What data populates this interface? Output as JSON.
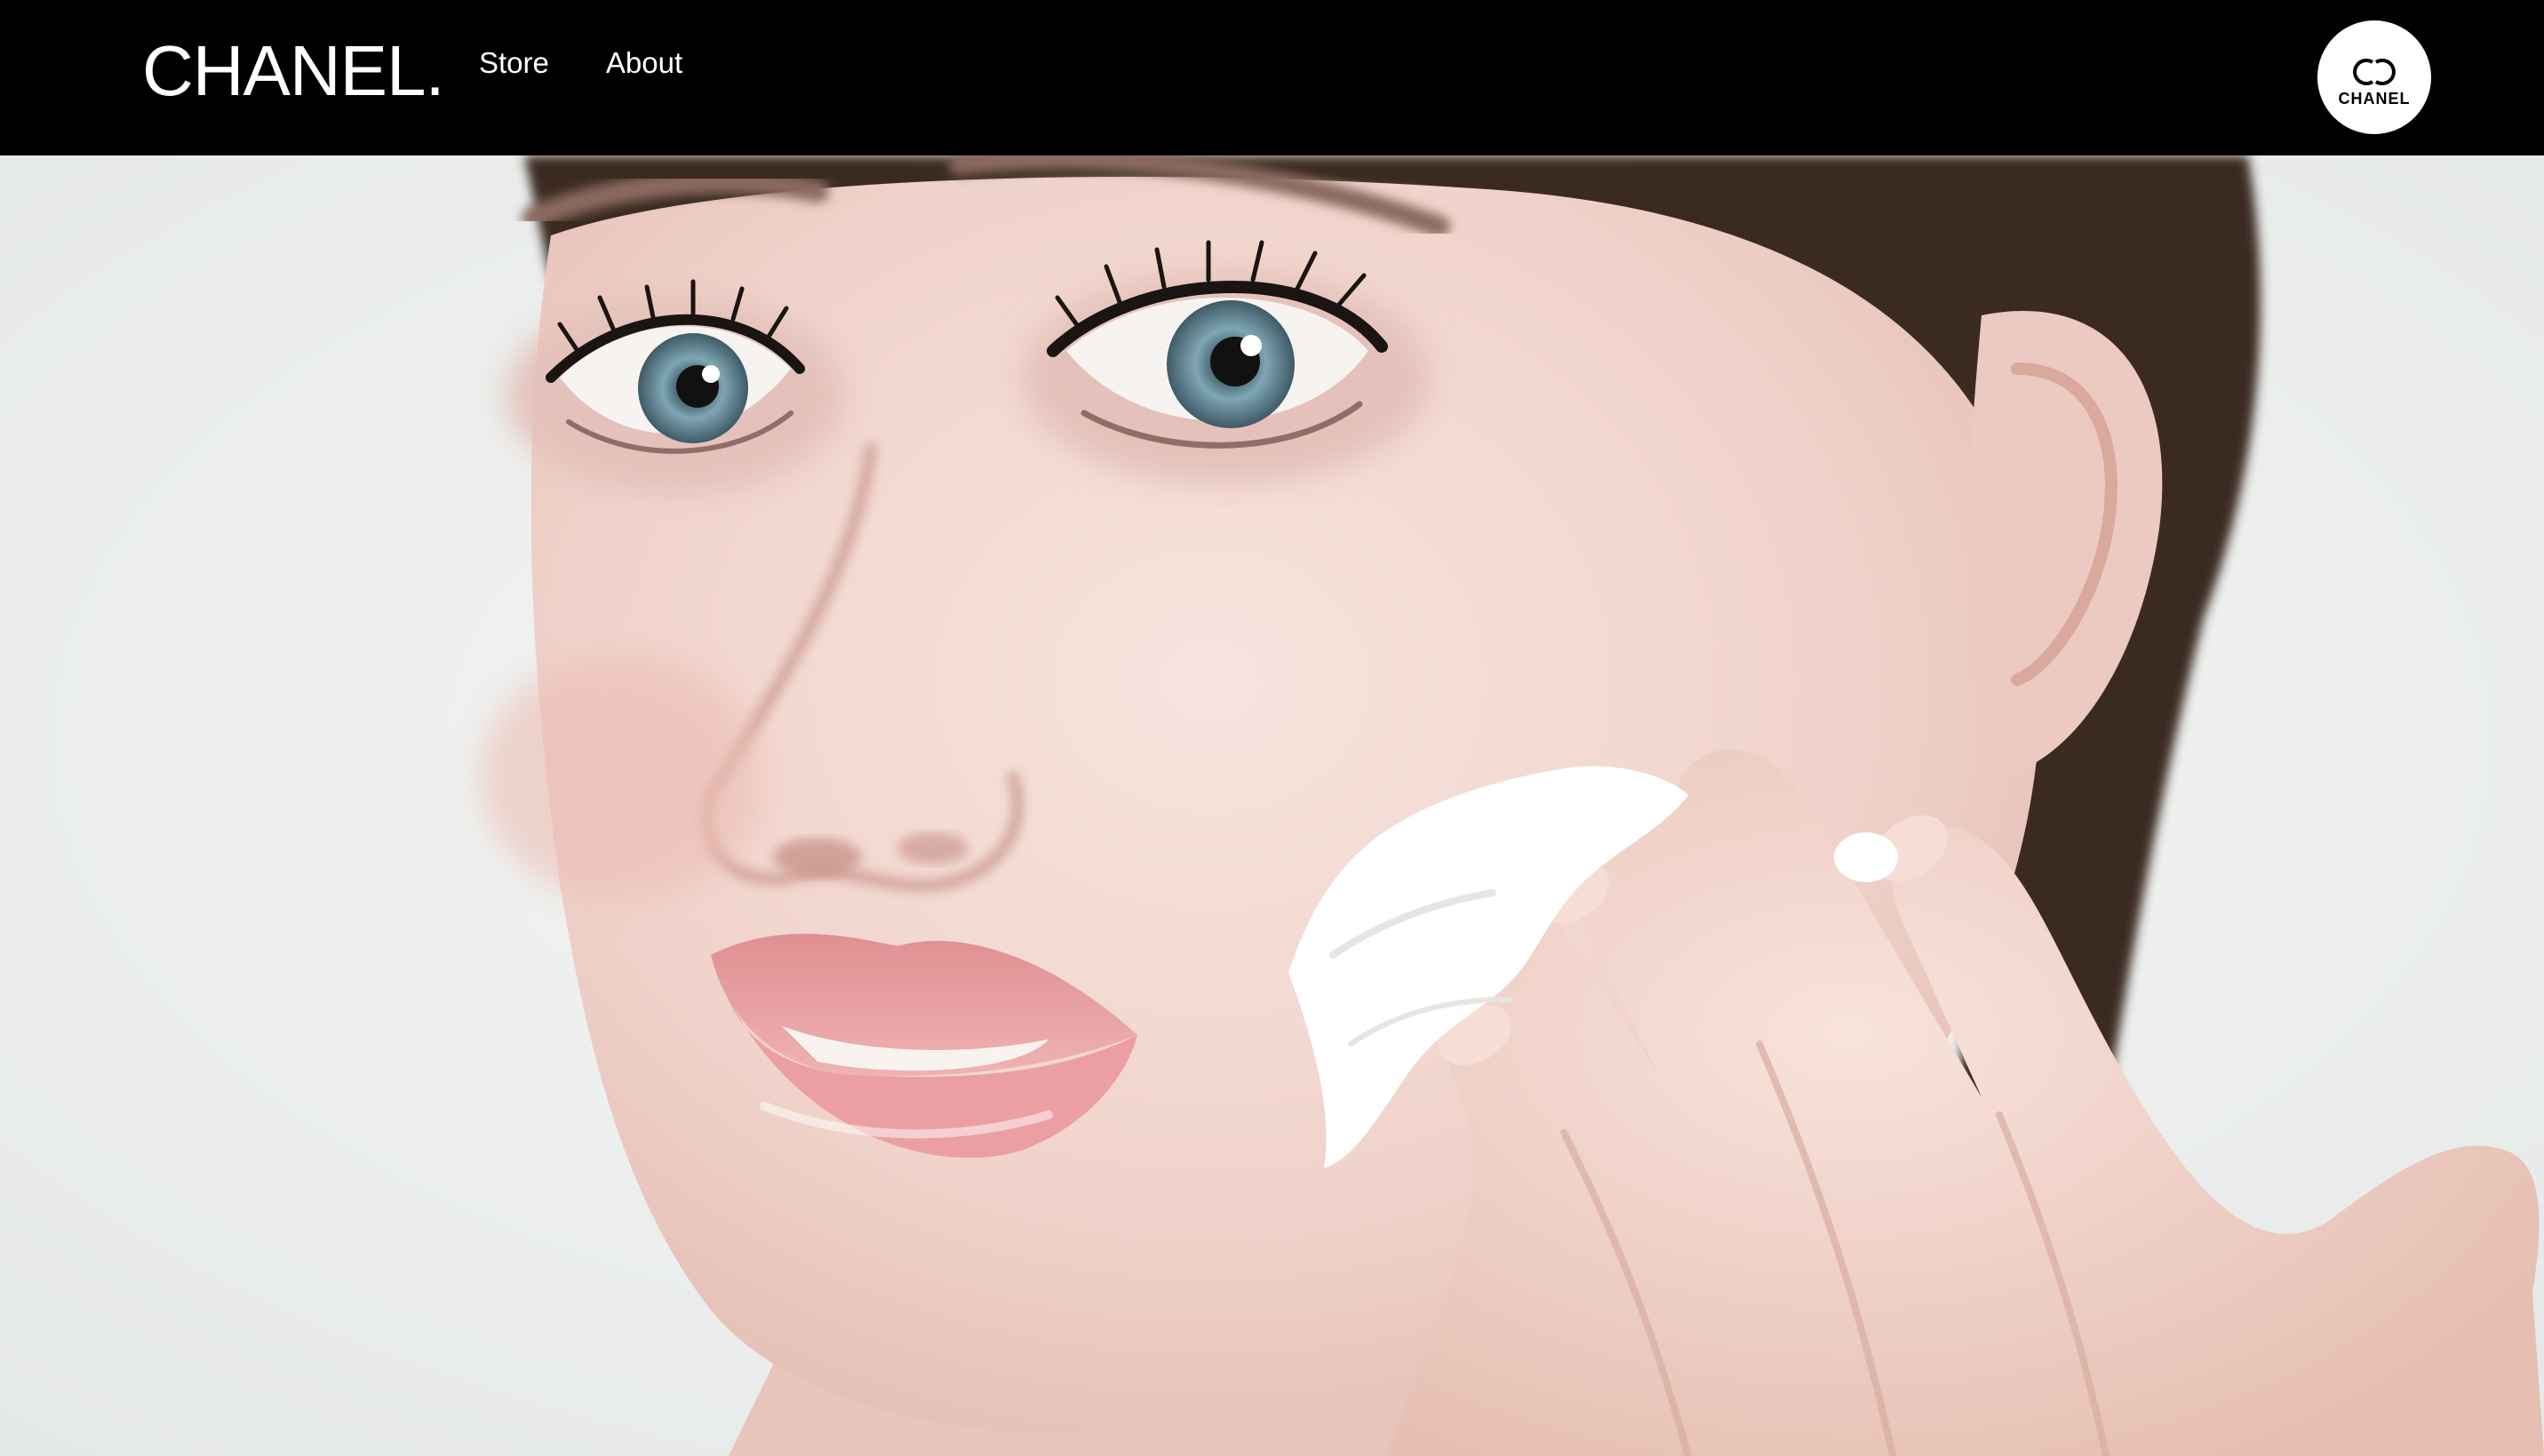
{
  "header": {
    "brand": "CHANEL.",
    "nav": [
      {
        "label": "Store"
      },
      {
        "label": "About"
      }
    ],
    "badge": {
      "text": "CHANEL",
      "icon": "chanel-cc-logo-icon"
    }
  },
  "hero": {
    "image": "beauty-portrait-applying-cream",
    "colors": {
      "background": "#eef0ee",
      "skin": "#f2d8d2",
      "hair": "#3a2a24",
      "iris": "#7fa6b4",
      "lips": "#e49a9c",
      "cream": "#ffffff"
    }
  }
}
